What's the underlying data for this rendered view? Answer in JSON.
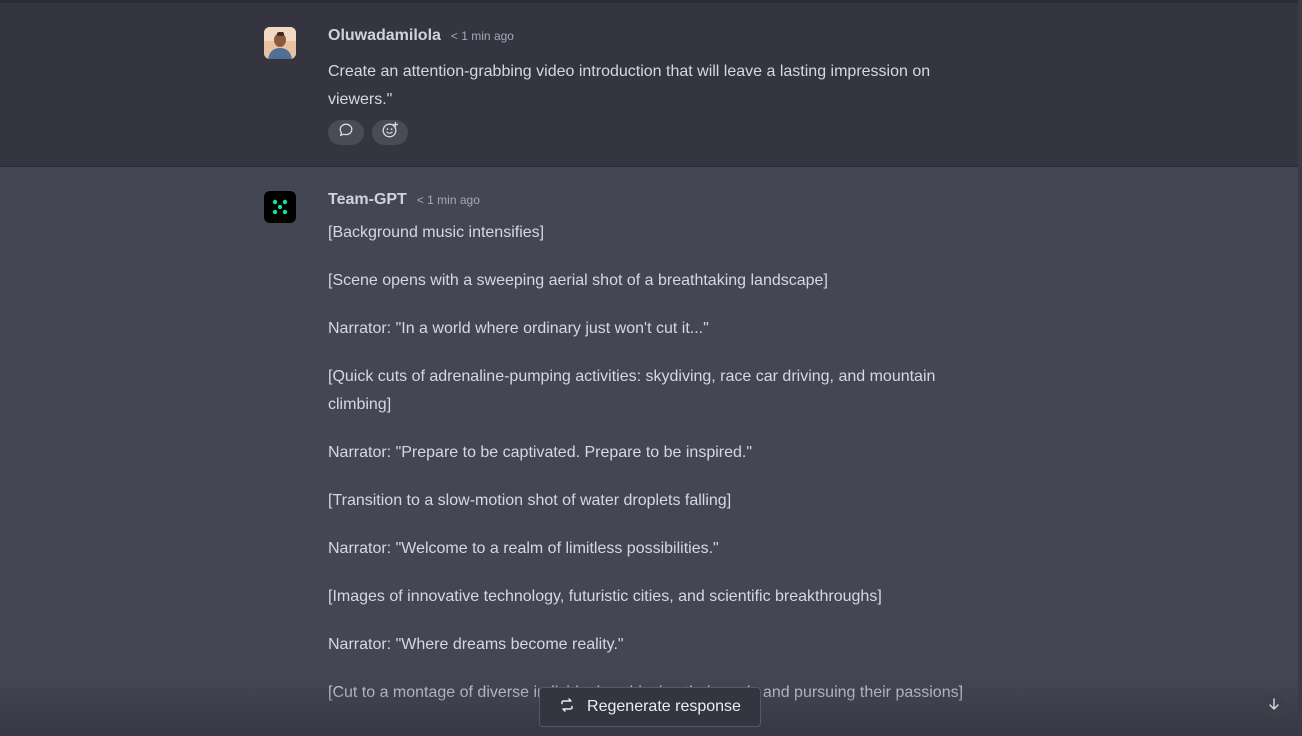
{
  "user_message": {
    "author": "Oluwadamilola",
    "time": "< 1 min ago",
    "text": "Create an attention-grabbing video introduction that will leave a lasting impression on viewers.\"",
    "actions": [
      {
        "icon": "comment-icon"
      },
      {
        "icon": "add-reaction-icon"
      }
    ]
  },
  "ai_message": {
    "author": "Team-GPT",
    "time": "< 1 min ago",
    "paragraphs": [
      "[Background music intensifies]",
      "[Scene opens with a sweeping aerial shot of a breathtaking landscape]",
      "Narrator: \"In a world where ordinary just won't cut it...\"",
      "[Quick cuts of adrenaline-pumping activities: skydiving, race car driving, and mountain climbing]",
      "Narrator: \"Prepare to be captivated. Prepare to be inspired.\"",
      "[Transition to a slow-motion shot of water droplets falling]",
      "Narrator: \"Welcome to a realm of limitless possibilities.\"",
      "[Images of innovative technology, futuristic cities, and scientific breakthroughs]",
      "Narrator: \"Where dreams become reality.\"",
      "[Cut to a montage of diverse individuals achieving their goals and pursuing their passions]"
    ]
  },
  "controls": {
    "regenerate_label": "Regenerate response",
    "regenerate_icon": "refresh-icon",
    "scroll_down_icon": "arrow-down-icon"
  },
  "colors": {
    "user_bg": "#343541",
    "ai_bg": "#444654",
    "ai_logo_green": "#19e0a0"
  }
}
